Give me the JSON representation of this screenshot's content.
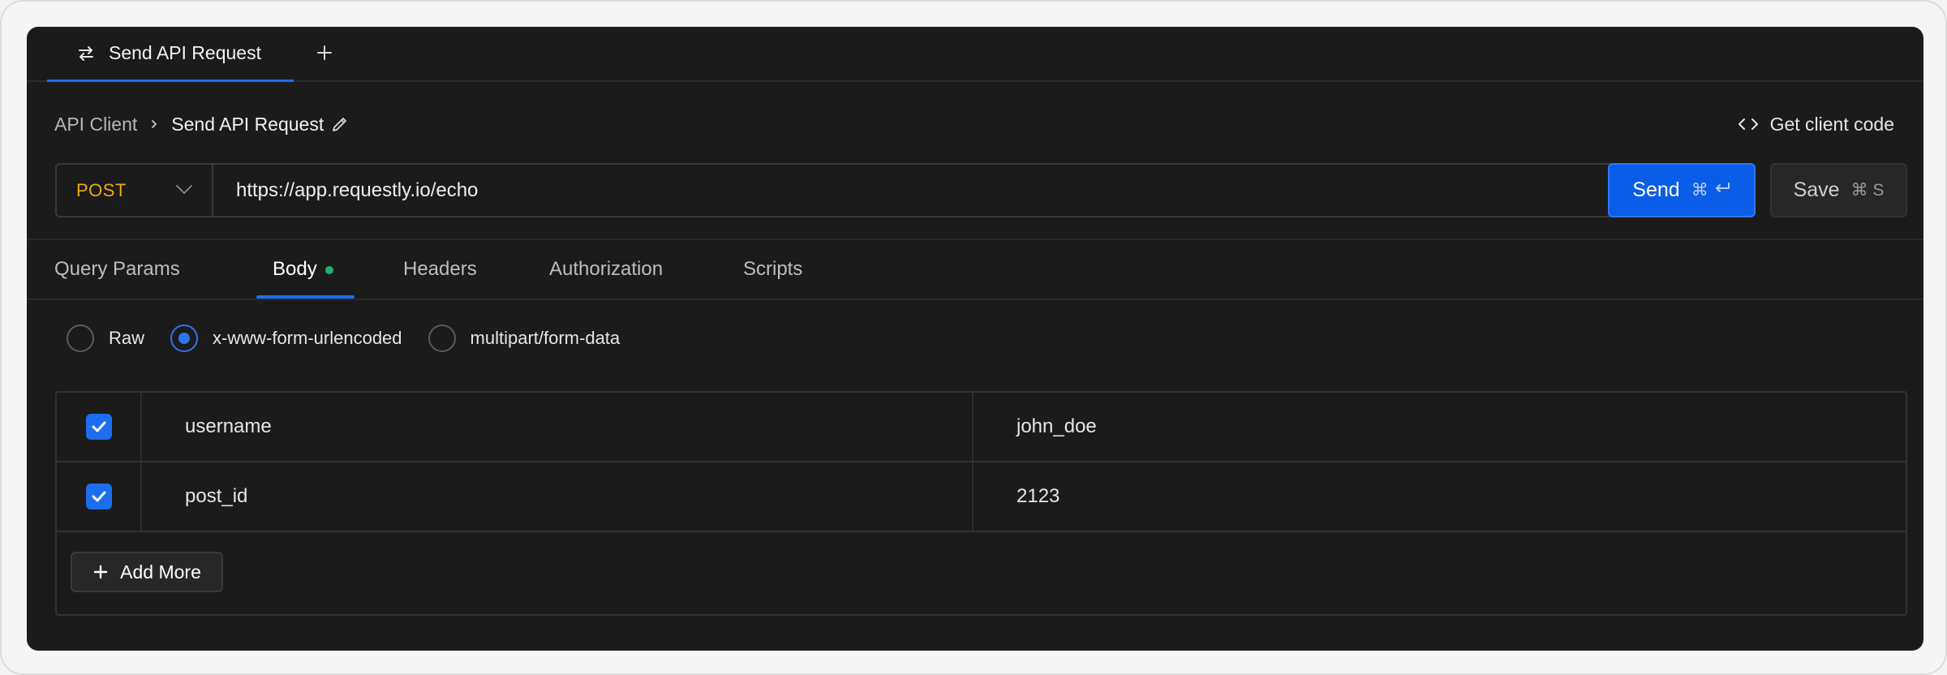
{
  "tabs": [
    {
      "label": "Send API Request",
      "icon": "arrows-swap-icon",
      "active": true
    }
  ],
  "add_tab_icon": "plus-icon",
  "breadcrumb": {
    "root": "API Client",
    "current": "Send API Request"
  },
  "client_code": {
    "label": "Get client code",
    "icon": "code-icon"
  },
  "request": {
    "method": "POST",
    "method_color": "#f0a90e",
    "url": "https://app.requestly.io/echo"
  },
  "actions": {
    "send_label": "Send",
    "send_shortcut": "⌘",
    "save_label": "Save",
    "save_shortcut": "⌘ S"
  },
  "request_tabs": [
    {
      "label": "Query Params",
      "active": false
    },
    {
      "label": "Body",
      "active": true,
      "has_indicator": true
    },
    {
      "label": "Headers",
      "active": false
    },
    {
      "label": "Authorization",
      "active": false
    },
    {
      "label": "Scripts",
      "active": false
    }
  ],
  "body_types": [
    {
      "label": "Raw",
      "checked": false
    },
    {
      "label": "x-www-form-urlencoded",
      "checked": true
    },
    {
      "label": "multipart/form-data",
      "checked": false
    }
  ],
  "form_rows": [
    {
      "enabled": true,
      "key": "username",
      "value": "john_doe"
    },
    {
      "enabled": true,
      "key": "post_id",
      "value": "2123"
    }
  ],
  "add_more_label": "Add More",
  "colors": {
    "accent": "#1d6df0",
    "indicator": "#1fb16b",
    "background": "#1b1b1b"
  }
}
